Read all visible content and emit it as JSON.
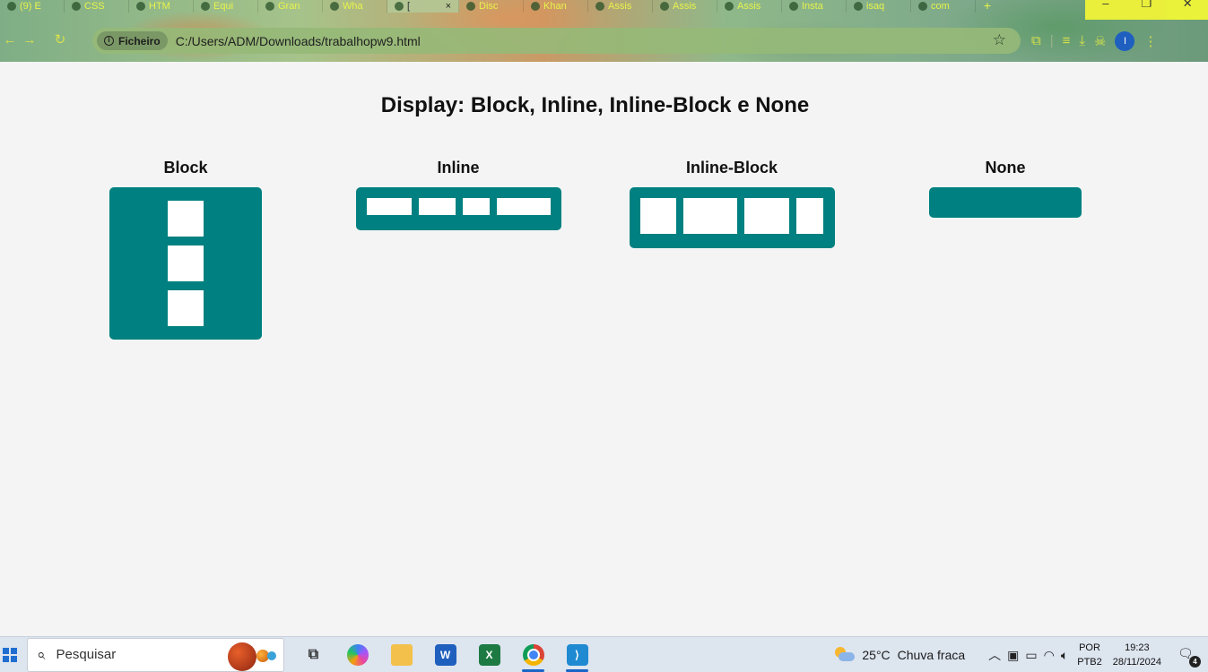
{
  "browser": {
    "tabs": [
      {
        "label": "(9) E",
        "active": false
      },
      {
        "label": "CSS",
        "active": false
      },
      {
        "label": "HTM",
        "active": false
      },
      {
        "label": "Equi",
        "active": false
      },
      {
        "label": "Gran",
        "active": false
      },
      {
        "label": "Wha",
        "active": false
      },
      {
        "label": "[",
        "active": true
      },
      {
        "label": "Disc",
        "active": false
      },
      {
        "label": "Khan",
        "active": false
      },
      {
        "label": "Assis",
        "active": false
      },
      {
        "label": "Assis",
        "active": false
      },
      {
        "label": "Assis",
        "active": false
      },
      {
        "label": "Insta",
        "active": false
      },
      {
        "label": "isaq",
        "active": false
      },
      {
        "label": "com",
        "active": false
      }
    ],
    "new_tab": "+",
    "active_tab_close": "×",
    "address": {
      "chip_label": "Ficheiro",
      "url": "C:/Users/ADM/Downloads/trabalhopw9.html"
    },
    "profile_initial": "I"
  },
  "page": {
    "title": "Display: Block, Inline, Inline-Block e None",
    "sections": {
      "block": {
        "heading": "Block",
        "items": 3
      },
      "inline": {
        "heading": "Inline",
        "items": 4
      },
      "inline_block": {
        "heading": "Inline-Block",
        "items": 4
      },
      "none": {
        "heading": "None",
        "items": 0
      }
    },
    "accent_color": "#008080"
  },
  "taskbar": {
    "search_placeholder": "Pesquisar",
    "weather": {
      "temp": "25°C",
      "condition": "Chuva fraca"
    },
    "language": {
      "line1": "POR",
      "line2": "PTB2"
    },
    "clock": {
      "time": "19:23",
      "date": "28/11/2024"
    },
    "notifications": "4"
  }
}
